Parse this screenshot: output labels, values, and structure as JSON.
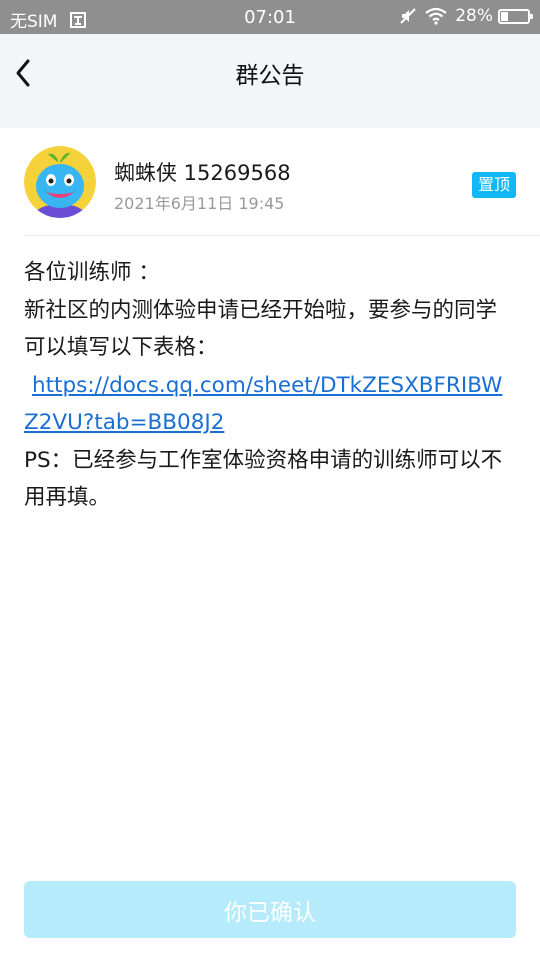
{
  "status_bar": {
    "carrier": "无SIM",
    "time": "07:01",
    "battery": "28%",
    "battery_level": 0.28
  },
  "header": {
    "title": "群公告"
  },
  "post": {
    "author": "蜘蛛侠 15269568",
    "timestamp": "2021年6月11日 19:45",
    "badge": "置顶",
    "lines": [
      "各位训练师 ：",
      "新社区的内测体验申请已经开始啦，要参与的同学可以填写以下表格："
    ],
    "link": "https://docs.qq.com/sheet/DTkZESXBFRIBWZ2VU?tab=BB08J2",
    "closing": "PS：已经参与工作室体验资格申请的训练师可以不用再填。"
  },
  "confirm_button": {
    "label": "你已确认"
  },
  "colors": {
    "status_bar_bg": "#8f8f8f",
    "header_bg": "#f4f5f7",
    "badge_bg": "#12b7f5",
    "link": "#1a6fd4",
    "button_bg": "#b5ebfb"
  },
  "icons": {
    "back": "chevron-left-icon",
    "sim_status": "no-sim-icon",
    "mute": "mute-icon",
    "wifi": "wifi-icon",
    "battery": "battery-icon"
  }
}
